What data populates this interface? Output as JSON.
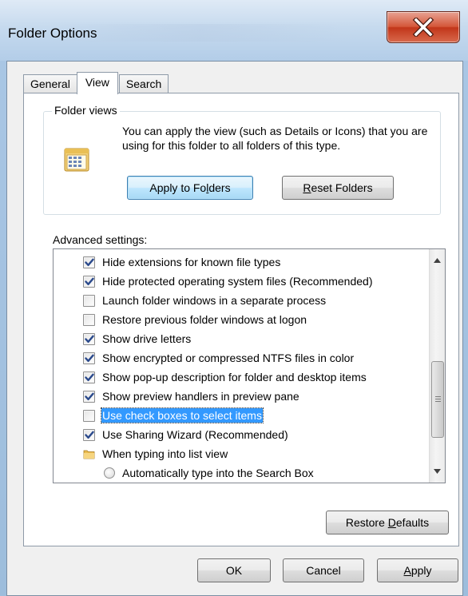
{
  "window": {
    "title": "Folder Options"
  },
  "tabs": [
    {
      "label": "General"
    },
    {
      "label": "View"
    },
    {
      "label": "Search"
    }
  ],
  "folder_views": {
    "legend": "Folder views",
    "description": "You can apply the view (such as Details or Icons) that you are using for this folder to all folders of this type.",
    "apply_button": {
      "pre": "Apply to Fo",
      "key": "l",
      "post": "ders"
    },
    "reset_button": {
      "pre": "",
      "key": "R",
      "post": "eset Folders"
    }
  },
  "advanced": {
    "label": "Advanced settings:",
    "items": [
      {
        "text": "Hide extensions for known file types",
        "type": "checkbox",
        "checked": true
      },
      {
        "text": "Hide protected operating system files (Recommended)",
        "type": "checkbox",
        "checked": true
      },
      {
        "text": "Launch folder windows in a separate process",
        "type": "checkbox",
        "checked": false
      },
      {
        "text": "Restore previous folder windows at logon",
        "type": "checkbox",
        "checked": false
      },
      {
        "text": "Show drive letters",
        "type": "checkbox",
        "checked": true
      },
      {
        "text": "Show encrypted or compressed NTFS files in color",
        "type": "checkbox",
        "checked": true
      },
      {
        "text": "Show pop-up description for folder and desktop items",
        "type": "checkbox",
        "checked": true
      },
      {
        "text": "Show preview handlers in preview pane",
        "type": "checkbox",
        "checked": true
      },
      {
        "text": "Use check boxes to select items",
        "type": "checkbox",
        "checked": false,
        "selected": true
      },
      {
        "text": "Use Sharing Wizard (Recommended)",
        "type": "checkbox",
        "checked": true
      },
      {
        "text": "When typing into list view",
        "type": "folder"
      },
      {
        "text": "Automatically type into the Search Box",
        "type": "radio",
        "checked": false
      }
    ]
  },
  "restore_defaults": {
    "pre": "Restore ",
    "key": "D",
    "post": "efaults"
  },
  "footer": {
    "ok": "OK",
    "cancel": "Cancel",
    "apply": {
      "pre": "",
      "key": "A",
      "post": "pply"
    }
  },
  "colors": {
    "selection": "#3399ff",
    "close_button": "#c2361a",
    "checkmark": "#2b4a8c"
  }
}
